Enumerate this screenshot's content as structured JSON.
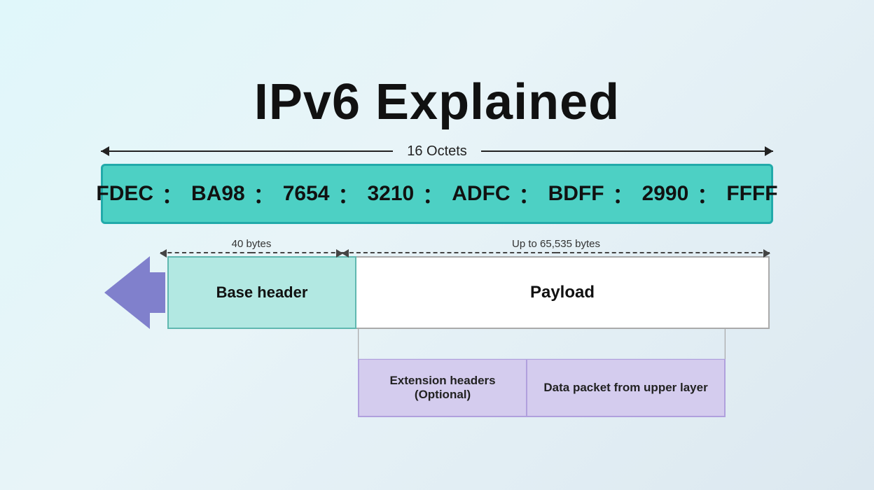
{
  "title": "IPv6 Explained",
  "octets_label": "16 Octets",
  "ipv6_segments": [
    "FDEC",
    "BA98",
    "7654",
    "3210",
    "ADFC",
    "BDFF",
    "2990",
    "FFFF"
  ],
  "forty_bytes_label": "40 bytes",
  "payload_bytes_label": "Up to 65,535 bytes",
  "base_header_label": "Base header",
  "payload_label": "Payload",
  "extension_headers_label": "Extension headers\n(Optional)",
  "data_packet_label": "Data packet from upper layer",
  "colors": {
    "teal_bar": "#4dd0c4",
    "base_header_bg": "#b2e8e2",
    "payload_bg": "#ffffff",
    "arrow_purple": "#8080cc",
    "bottom_box_bg": "#d4ccee",
    "background_top": "#e0f7fa",
    "background_bottom": "#c8e8f0"
  }
}
